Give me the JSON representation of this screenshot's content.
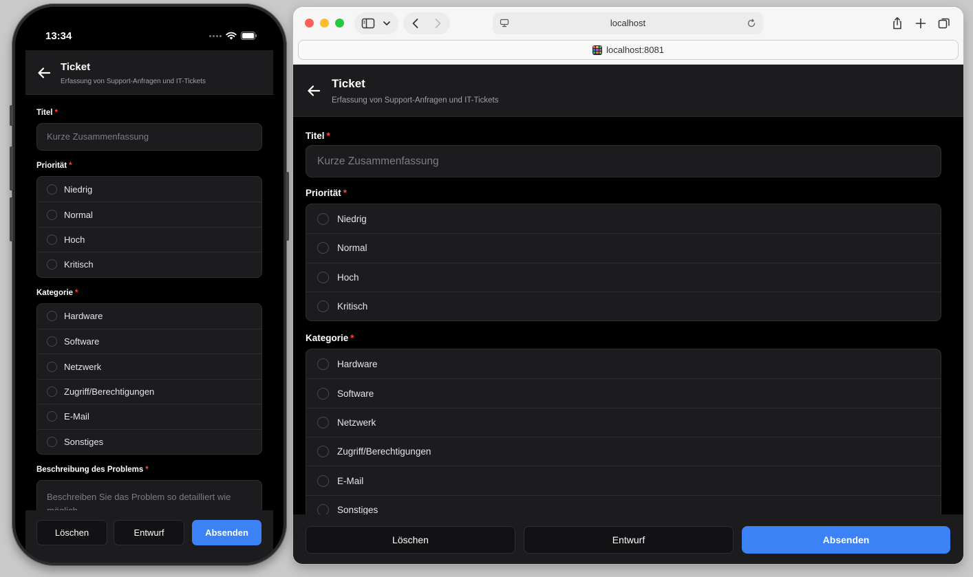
{
  "status_bar": {
    "time": "13:34"
  },
  "browser": {
    "address": "localhost",
    "tab_url": "localhost:8081"
  },
  "header": {
    "title": "Ticket",
    "subtitle": "Erfassung von Support-Anfragen und IT-Tickets"
  },
  "form": {
    "required_marker": "*",
    "title_field": {
      "label": "Titel",
      "placeholder": "Kurze Zusammenfassung"
    },
    "priority": {
      "label": "Priorität",
      "options": [
        "Niedrig",
        "Normal",
        "Hoch",
        "Kritisch"
      ]
    },
    "category": {
      "label": "Kategorie",
      "options": [
        "Hardware",
        "Software",
        "Netzwerk",
        "Zugriff/Berechtigungen",
        "E-Mail",
        "Sonstiges"
      ]
    },
    "description": {
      "label": "Beschreibung des Problems",
      "placeholder": "Beschreiben Sie das Problem so detailliert wie möglich..."
    }
  },
  "footer": {
    "clear_label": "Löschen",
    "draft_label": "Entwurf",
    "submit_label": "Absenden"
  },
  "colors": {
    "accent": "#3b82f6",
    "required": "#ff453a",
    "background": "#000000",
    "surface": "#1c1c1e"
  },
  "icons": {
    "back": "arrow-left-icon",
    "wifi": "wifi-icon",
    "battery": "battery-icon",
    "sidebar": "sidebar-icon",
    "reload": "reload-icon",
    "share": "share-icon",
    "new_tab": "plus-icon",
    "tabs": "tabs-overview-icon"
  }
}
